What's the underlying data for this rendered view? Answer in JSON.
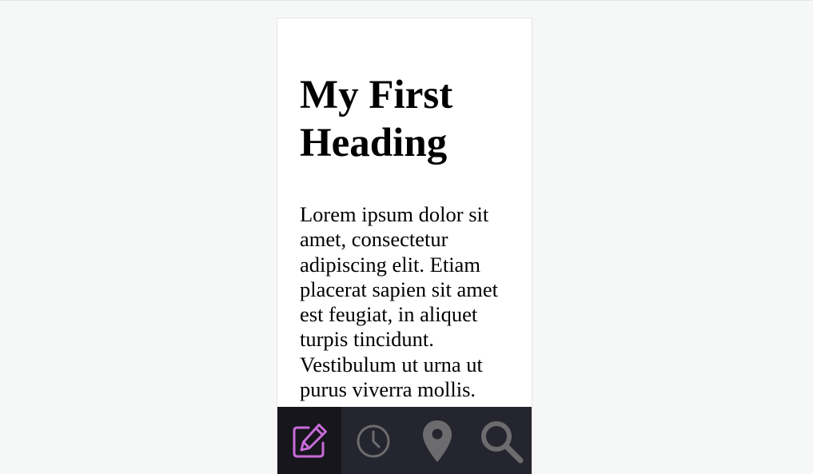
{
  "article": {
    "heading": "My First Heading",
    "body": "Lorem ipsum dolor sit amet, consectetur adipiscing elit. Etiam placerat sapien sit amet est feugiat, in aliquet turpis tincidunt. Vestibulum ut urna ut purus viverra mollis. Mauris"
  },
  "tabbar": {
    "tabs": [
      {
        "icon": "edit-icon",
        "active": true
      },
      {
        "icon": "clock-icon",
        "active": false
      },
      {
        "icon": "location-pin-icon",
        "active": false
      },
      {
        "icon": "search-icon",
        "active": false
      }
    ]
  },
  "colors": {
    "page_background": "#f6f8f8",
    "tabbar_background": "#25252f",
    "active_tab_background": "#17161d",
    "active_icon": "#c86bd8",
    "inactive_icon": "#6c6c6e"
  }
}
